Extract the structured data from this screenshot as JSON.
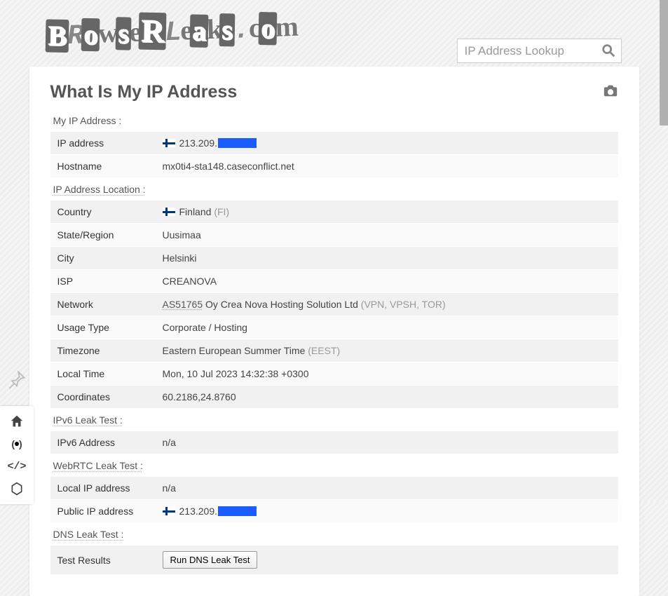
{
  "logo_text": "BrowseRLeaks.com",
  "search": {
    "placeholder": "IP Address Lookup"
  },
  "heading": "What Is My IP Address",
  "sections": {
    "my_ip": "My IP Address :",
    "location": "IP Address Location :",
    "ipv6": "IPv6 Leak Test :",
    "webrtc": "WebRTC Leak Test :",
    "dns": "DNS Leak Test :"
  },
  "labels": {
    "ip_address": "IP address",
    "hostname": "Hostname",
    "country": "Country",
    "state": "State/Region",
    "city": "City",
    "isp": "ISP",
    "network": "Network",
    "usage_type": "Usage Type",
    "timezone": "Timezone",
    "local_time": "Local Time",
    "coordinates": "Coordinates",
    "ipv6_address": "IPv6 Address",
    "local_ip": "Local IP address",
    "public_ip": "Public IP address",
    "test_results": "Test Results"
  },
  "values": {
    "ip_prefix": "213.209.",
    "hostname": "mx0ti4-sta148.caseconflict.net",
    "country": "Finland",
    "country_code": "(FI)",
    "state": "Uusimaa",
    "city": "Helsinki",
    "isp": "CREANOVA",
    "asn": "AS51765",
    "network_org": "Oy Crea Nova Hosting Solution Ltd",
    "network_tags": "(VPN, VPSH, TOR)",
    "usage_type": "Corporate / Hosting",
    "timezone": "Eastern European Summer Time",
    "timezone_abbr": "(EEST)",
    "local_time": "Mon, 10 Jul 2023 14:32:38 +0300",
    "coordinates": "60.2186,24.8760",
    "ipv6_address": "n/a",
    "local_ip": "n/a",
    "public_ip_prefix": "213.209."
  },
  "buttons": {
    "run_dns": "Run DNS Leak Test"
  }
}
